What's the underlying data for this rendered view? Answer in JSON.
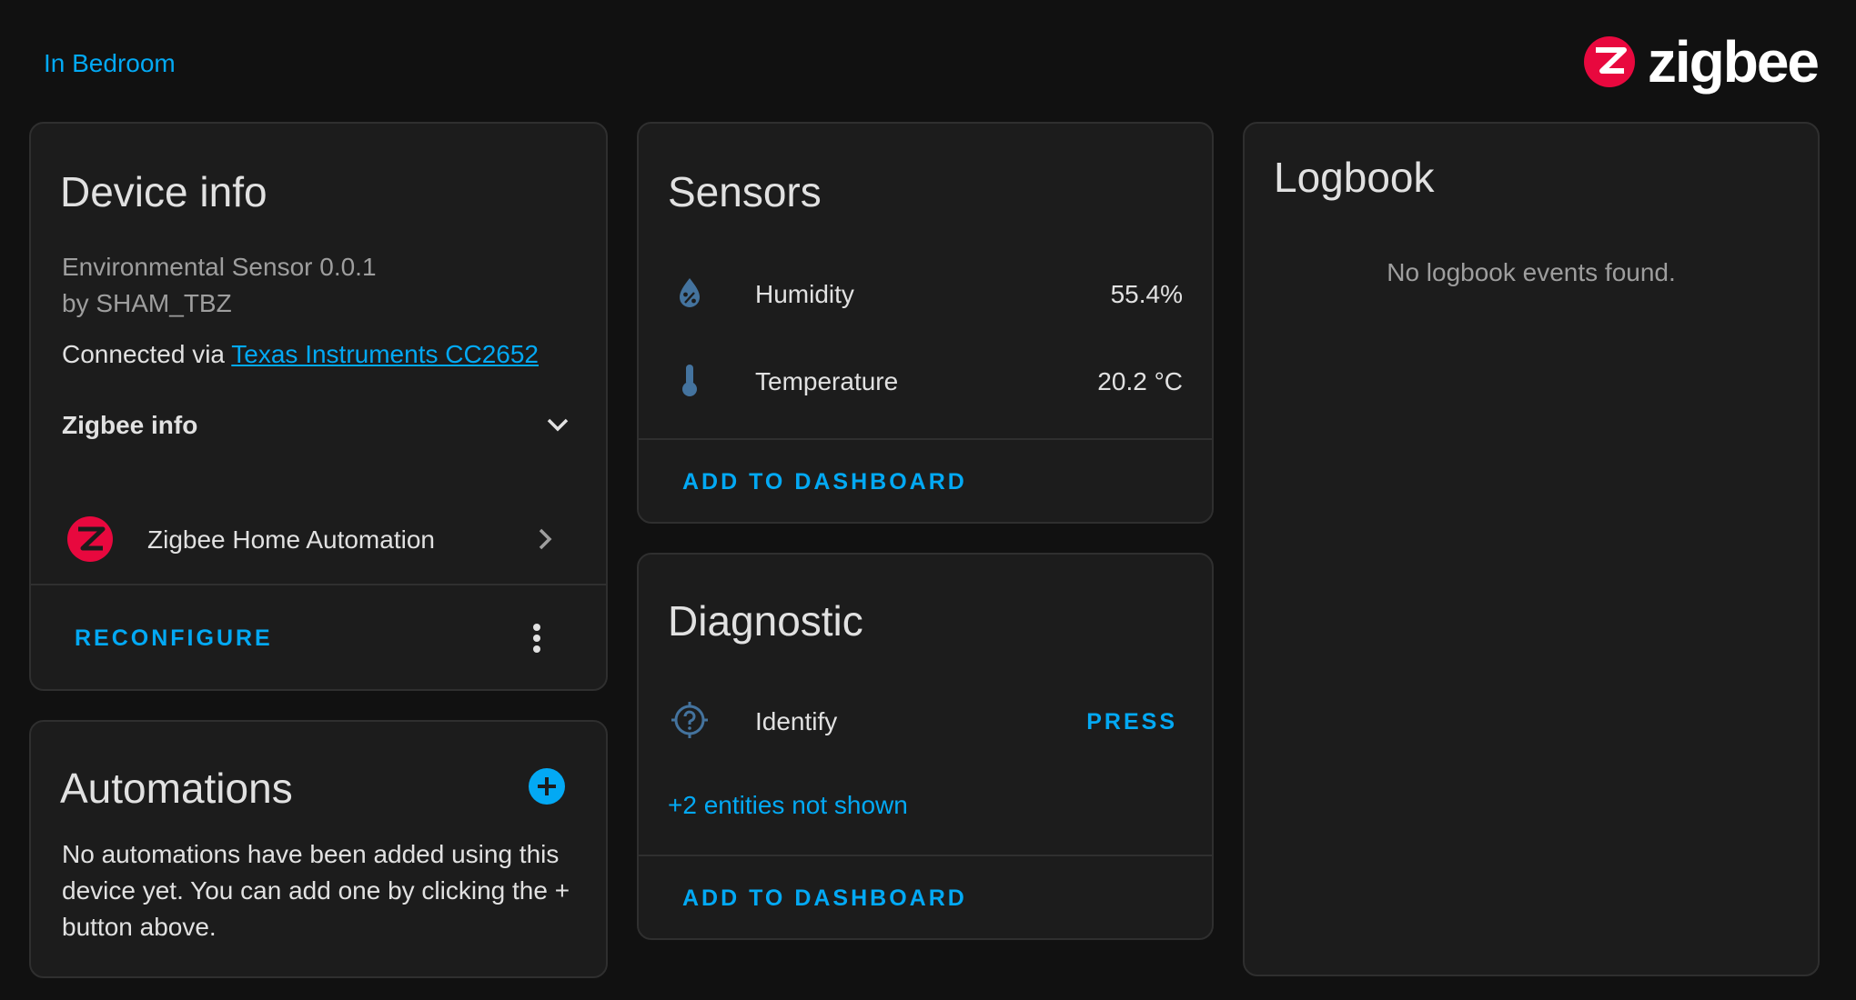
{
  "header": {
    "area_link": "In Bedroom",
    "brand_wordmark": "zigbee",
    "brand_color": "#e8083e"
  },
  "device_info": {
    "title": "Device info",
    "model": "Environmental Sensor 0.0.1",
    "manufacturer": "by SHAM_TBZ",
    "connected_prefix": "Connected via ",
    "connected_link": "Texas Instruments CC2652",
    "zigbee_info_label": "Zigbee info",
    "integration_label": "Zigbee Home Automation",
    "reconfigure_label": "RECONFIGURE"
  },
  "automations": {
    "title": "Automations",
    "empty_text": "No automations have been added using this device yet. You can add one by clicking the + button above."
  },
  "sensors": {
    "title": "Sensors",
    "entities": [
      {
        "name": "Humidity",
        "state": "55.4%",
        "icon": "water-percent-icon"
      },
      {
        "name": "Temperature",
        "state": "20.2 °C",
        "icon": "thermometer-icon"
      }
    ],
    "add_to_dashboard_label": "ADD TO DASHBOARD"
  },
  "diagnostic": {
    "title": "Diagnostic",
    "entities": [
      {
        "name": "Identify",
        "action": "PRESS",
        "icon": "crosshairs-question-icon"
      }
    ],
    "hidden_entities": "+2 entities not shown",
    "add_to_dashboard_label": "ADD TO DASHBOARD"
  },
  "logbook": {
    "title": "Logbook",
    "empty_text": "No logbook events found."
  },
  "colors": {
    "accent": "#03a9f4",
    "card_background": "#1c1c1c",
    "page_background": "#111111",
    "icon_blue": "#44739e"
  }
}
